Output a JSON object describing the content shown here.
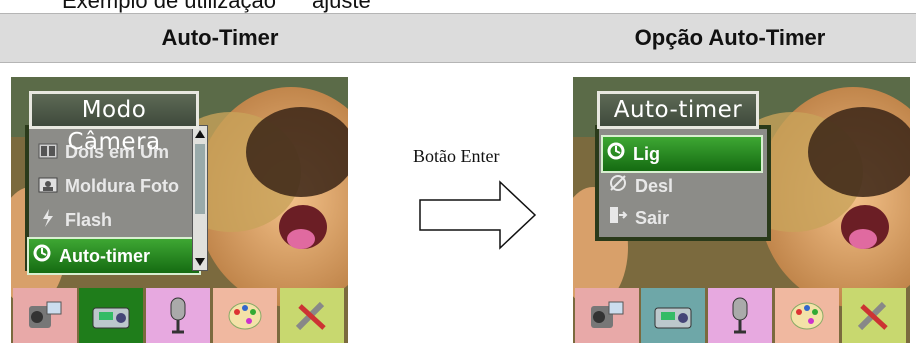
{
  "headers": {
    "left": "Auto-Timer",
    "right": "Opção Auto-Timer"
  },
  "top_fragments": {
    "left": "Exemplo de utilização",
    "right": "ajuste"
  },
  "arrow": {
    "label": "Botão Enter",
    "icon": "right-arrow-icon"
  },
  "left_screen": {
    "menu_title": "Modo Câmera",
    "items": [
      {
        "label": "Dois em Um",
        "icon": "two-in-one-icon",
        "selected": false
      },
      {
        "label": "Moldura Foto",
        "icon": "photo-frame-icon",
        "selected": false
      },
      {
        "label": "Flash",
        "icon": "flash-icon",
        "selected": false
      },
      {
        "label": "Auto-timer",
        "icon": "self-timer-icon",
        "selected": true
      }
    ],
    "tabs": [
      {
        "icon": "video-camera-icon",
        "color": "#e8a9a8"
      },
      {
        "icon": "camera-icon",
        "color": "#1f7d1b"
      },
      {
        "icon": "microphone-icon",
        "color": "#e7a9e0"
      },
      {
        "icon": "palette-icon",
        "color": "#f0b8a0"
      },
      {
        "icon": "tools-icon",
        "color": "#c8d86f"
      }
    ]
  },
  "right_screen": {
    "menu_title": "Auto-timer",
    "items": [
      {
        "label": "Lig",
        "icon": "self-timer-icon",
        "selected": true
      },
      {
        "label": "Desl",
        "icon": "self-timer-off-icon",
        "selected": false
      },
      {
        "label": "Sair",
        "icon": "exit-icon",
        "selected": false
      }
    ],
    "tabs": [
      {
        "icon": "video-camera-icon",
        "color": "#e8a9a8"
      },
      {
        "icon": "camera-icon",
        "color": "#6ea7a8"
      },
      {
        "icon": "microphone-icon",
        "color": "#e7a9e0"
      },
      {
        "icon": "palette-icon",
        "color": "#f0b8a0"
      },
      {
        "icon": "tools-icon",
        "color": "#c8d86f"
      }
    ]
  }
}
